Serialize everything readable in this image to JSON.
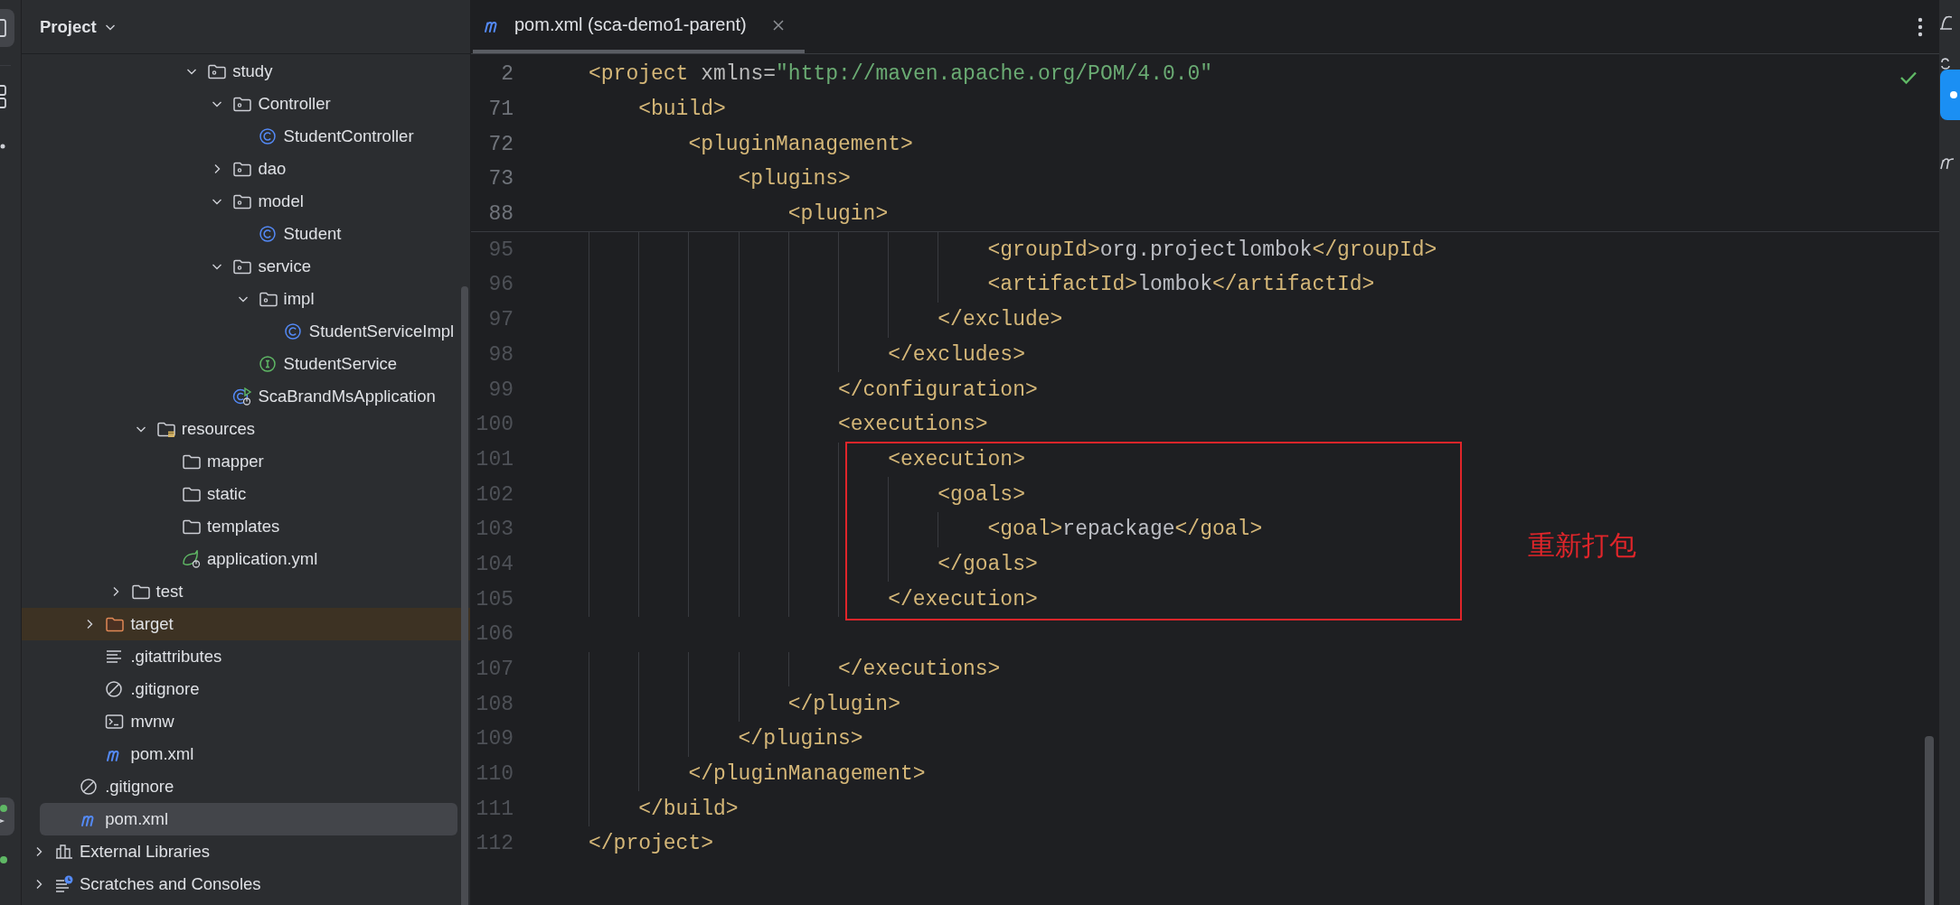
{
  "project_panel": {
    "title": "Project"
  },
  "project_tree": [
    {
      "children": [
        {
          "children": [
            {
              "children": [
                {
                  "children": [
                    {
                      "children": [
                        {
                          "children": [
                            {
                              "label": "study",
                              "kind": "package",
                              "expanded": true,
                              "selected": false,
                              "children": [
                                {
                                  "label": "Controller",
                                  "kind": "package",
                                  "expanded": true,
                                  "selected": false,
                                  "children": [
                                    {
                                      "label": "StudentController",
                                      "kind": "class",
                                      "selected": false
                                    }
                                  ]
                                },
                                {
                                  "label": "dao",
                                  "kind": "package",
                                  "expanded": false,
                                  "selected": false
                                },
                                {
                                  "label": "model",
                                  "kind": "package",
                                  "expanded": true,
                                  "selected": false,
                                  "children": [
                                    {
                                      "label": "Student",
                                      "kind": "class",
                                      "selected": false
                                    }
                                  ]
                                },
                                {
                                  "label": "service",
                                  "kind": "package",
                                  "expanded": true,
                                  "selected": false,
                                  "children": [
                                    {
                                      "label": "impl",
                                      "kind": "package",
                                      "expanded": true,
                                      "selected": false,
                                      "children": [
                                        {
                                          "label": "StudentServiceImpl",
                                          "kind": "class",
                                          "selected": false
                                        }
                                      ]
                                    },
                                    {
                                      "label": "StudentService",
                                      "kind": "interface",
                                      "selected": false
                                    }
                                  ]
                                },
                                {
                                  "label": "ScaBrandMsApplication",
                                  "kind": "application",
                                  "selected": false
                                }
                              ]
                            }
                          ]
                        }
                      ]
                    },
                    {
                      "label": "resources",
                      "kind": "resources",
                      "expanded": true,
                      "selected": false,
                      "children": [
                        {
                          "label": "mapper",
                          "kind": "folder",
                          "selected": false
                        },
                        {
                          "label": "static",
                          "kind": "folder",
                          "selected": false
                        },
                        {
                          "label": "templates",
                          "kind": "folder",
                          "selected": false
                        },
                        {
                          "label": "application.yml",
                          "kind": "config",
                          "selected": false
                        }
                      ]
                    }
                  ]
                },
                {
                  "label": "test",
                  "kind": "folder",
                  "expanded": false,
                  "selected": false
                }
              ]
            },
            {
              "label": "target",
              "kind": "excluded",
              "expanded": false,
              "selected": false
            },
            {
              "label": ".gitattributes",
              "kind": "text",
              "selected": false
            },
            {
              "label": ".gitignore",
              "kind": "ignore",
              "selected": false
            },
            {
              "label": "mvnw",
              "kind": "script",
              "selected": false
            },
            {
              "label": "pom.xml",
              "kind": "maven",
              "selected": false
            }
          ]
        },
        {
          "label": ".gitignore",
          "kind": "ignore",
          "selected": false
        },
        {
          "label": "pom.xml",
          "kind": "maven",
          "selected": true
        }
      ]
    },
    {
      "label": "External Libraries",
      "kind": "libraries",
      "expanded": false,
      "selected": false
    },
    {
      "label": "Scratches and Consoles",
      "kind": "scratches",
      "expanded": false,
      "selected": false
    }
  ],
  "editor": {
    "tab": {
      "label": "pom.xml (sca-demo1-parent)",
      "selected": true
    },
    "sticky_lines": [
      {
        "number": "2",
        "code": "<project xmlns=\"http://maven.apache.org/POM/4.0.0\""
      },
      {
        "number": "71",
        "code": "    <build>"
      },
      {
        "number": "72",
        "code": "        <pluginManagement>"
      },
      {
        "number": "73",
        "code": "            <plugins>"
      },
      {
        "number": "88",
        "code": "                <plugin>"
      }
    ],
    "lines": [
      {
        "number": "95",
        "code": "                                <groupId>org.projectlombok</groupId>",
        "annotated": false
      },
      {
        "number": "96",
        "code": "                                <artifactId>lombok</artifactId>",
        "annotated": false
      },
      {
        "number": "97",
        "code": "                            </exclude>",
        "annotated": false
      },
      {
        "number": "98",
        "code": "                        </excludes>",
        "annotated": false
      },
      {
        "number": "99",
        "code": "                    </configuration>",
        "annotated": false
      },
      {
        "number": "100",
        "code": "                    <executions>",
        "annotated": false
      },
      {
        "number": "101",
        "code": "                        <execution>",
        "annotated": true
      },
      {
        "number": "102",
        "code": "                            <goals>",
        "annotated": true
      },
      {
        "number": "103",
        "code": "                                <goal>repackage</goal>",
        "annotated": true
      },
      {
        "number": "104",
        "code": "                            </goals>",
        "annotated": true
      },
      {
        "number": "105",
        "code": "                        </execution>",
        "annotated": true
      },
      {
        "number": "106",
        "annotated": false
      },
      {
        "number": "107",
        "code": "                    </executions>",
        "annotated": false
      },
      {
        "number": "108",
        "code": "                </plugin>",
        "annotated": false
      },
      {
        "number": "109",
        "code": "            </plugins>",
        "annotated": false
      },
      {
        "number": "110",
        "code": "        </pluginManagement>",
        "annotated": false
      },
      {
        "number": "111",
        "code": "    </build>",
        "annotated": false
      },
      {
        "number": "112",
        "code": "</project>",
        "annotated": false
      }
    ],
    "annotation": {
      "note": "重新打包"
    }
  }
}
